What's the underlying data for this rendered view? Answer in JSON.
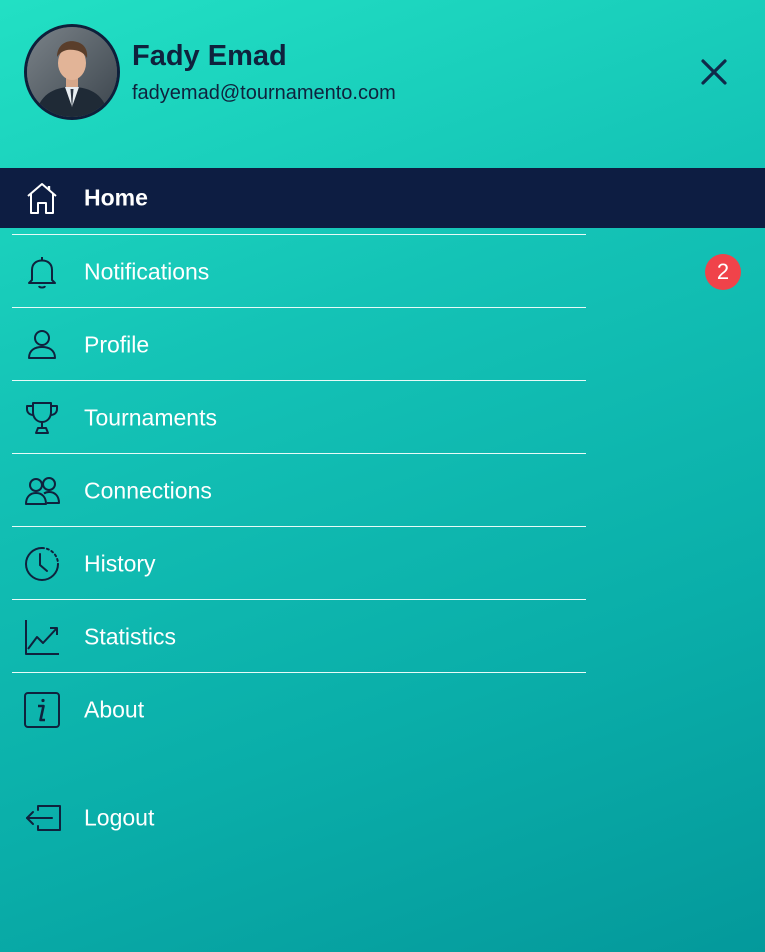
{
  "user": {
    "name": "Fady Emad",
    "email": "fadyemad@tournamento.com"
  },
  "menu": {
    "items": [
      {
        "label": "Home",
        "icon": "home-icon",
        "active": true
      },
      {
        "label": "Notifications",
        "icon": "bell-icon",
        "badge": "2"
      },
      {
        "label": "Profile",
        "icon": "user-icon"
      },
      {
        "label": "Tournaments",
        "icon": "trophy-icon"
      },
      {
        "label": "Connections",
        "icon": "people-icon"
      },
      {
        "label": "History",
        "icon": "clock-history-icon"
      },
      {
        "label": "Statistics",
        "icon": "chart-line-icon"
      },
      {
        "label": "About",
        "icon": "info-icon"
      }
    ],
    "logout_label": "Logout"
  },
  "colors": {
    "gradient_start": "#22e0c4",
    "gradient_end": "#04999b",
    "active_bg": "#0d1d42",
    "text_dark": "#0f223d",
    "badge": "#f0434a"
  }
}
